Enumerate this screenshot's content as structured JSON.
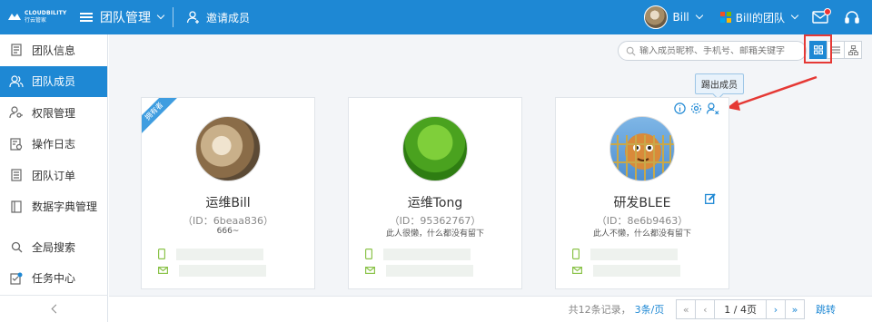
{
  "header": {
    "logo_line1": "CLOUDBILITY",
    "logo_line2": "行云管家",
    "title": "团队管理",
    "invite_label": "邀请成员",
    "user_name": "Bill",
    "team_name": "Bill的团队"
  },
  "sidebar": {
    "items": [
      {
        "label": "团队信息",
        "icon": "document-icon"
      },
      {
        "label": "团队成员",
        "icon": "users-icon"
      },
      {
        "label": "权限管理",
        "icon": "user-key-icon"
      },
      {
        "label": "操作日志",
        "icon": "log-icon"
      },
      {
        "label": "团队订单",
        "icon": "order-icon"
      },
      {
        "label": "数据字典管理",
        "icon": "dictionary-icon"
      },
      {
        "label": "全局搜索",
        "icon": "search-icon"
      },
      {
        "label": "任务中心",
        "icon": "task-icon"
      }
    ],
    "active_index": 1
  },
  "toolbar": {
    "search_placeholder": "输入成员昵称、手机号、邮箱关键字",
    "tooltip": "踢出成员"
  },
  "members": [
    {
      "name": "运维Bill",
      "id_text": "（ID：6beaa836）",
      "desc": "666~",
      "badge": "拥有者"
    },
    {
      "name": "运维Tong",
      "id_text": "（ID：95362767）",
      "desc": "此人很懒，什么都没有留下"
    },
    {
      "name": "研发BLEE",
      "id_text": "（ID：8e6b9463）",
      "desc": "此人不懒，什么都没有留下"
    }
  ],
  "pagination": {
    "total_text": "共12条记录，",
    "per_page": "3条/页",
    "page_info": "1 / 4页",
    "jump_label": "跳转",
    "first": "«",
    "prev": "‹",
    "next": "›",
    "last": "»"
  },
  "colors": {
    "primary": "#1e88d4",
    "highlight": "#e53935",
    "owner_badge": "#3f9de0"
  }
}
